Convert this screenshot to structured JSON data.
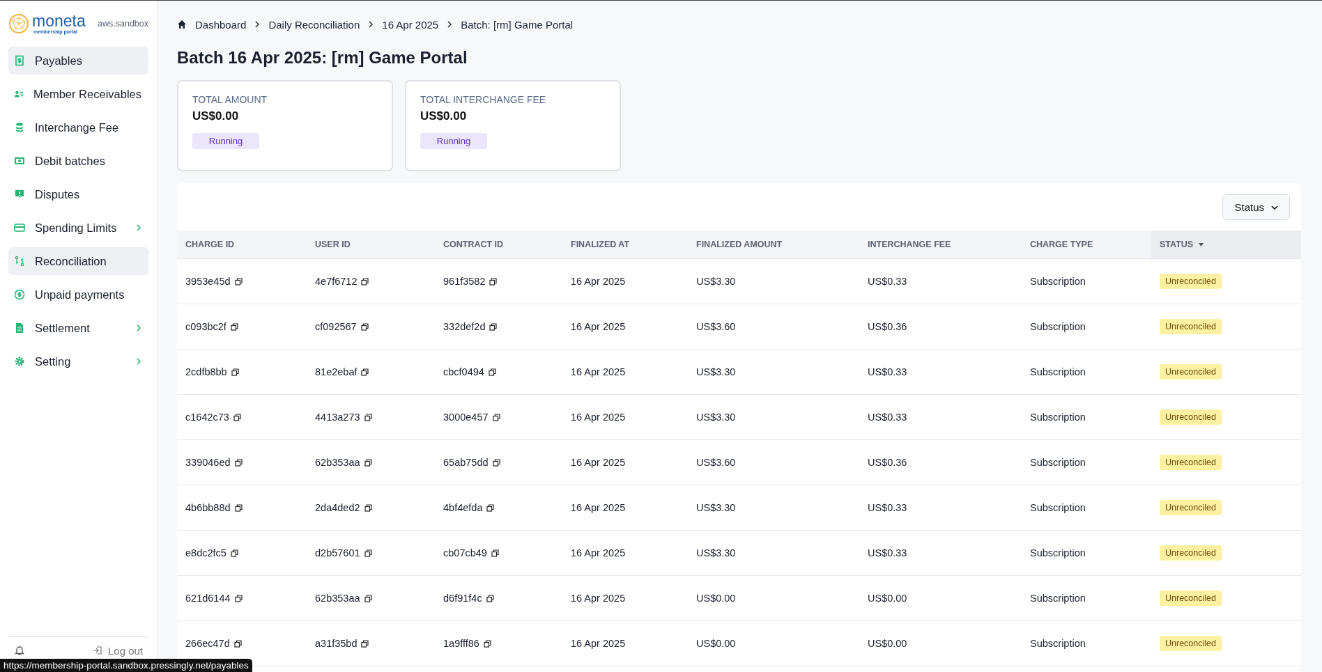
{
  "sidebar": {
    "logo": {
      "name": "moneta",
      "tagline": "membership portal"
    },
    "environment": "aws.sandbox",
    "items": [
      {
        "label": "Payables",
        "highlighted": true,
        "expandable": false
      },
      {
        "label": "Member Receivables",
        "highlighted": false,
        "expandable": false
      },
      {
        "label": "Interchange Fee",
        "highlighted": false,
        "expandable": false
      },
      {
        "label": "Debit batches",
        "highlighted": false,
        "expandable": false
      },
      {
        "label": "Disputes",
        "highlighted": false,
        "expandable": false
      },
      {
        "label": "Spending Limits",
        "highlighted": false,
        "expandable": true
      },
      {
        "label": "Reconciliation",
        "highlighted": true,
        "expandable": false
      },
      {
        "label": "Unpaid payments",
        "highlighted": false,
        "expandable": false
      },
      {
        "label": "Settlement",
        "highlighted": false,
        "expandable": true
      },
      {
        "label": "Setting",
        "highlighted": false,
        "expandable": true
      }
    ],
    "logout": "Log out"
  },
  "breadcrumbs": [
    "Dashboard",
    "Daily Reconciliation",
    "16 Apr 2025",
    "Batch: [rm] Game Portal"
  ],
  "title": "Batch 16 Apr 2025: [rm] Game Portal",
  "summary_cards": [
    {
      "label": "TOTAL AMOUNT",
      "value": "US$0.00",
      "status": "Running"
    },
    {
      "label": "TOTAL INTERCHANGE FEE",
      "value": "US$0.00",
      "status": "Running"
    }
  ],
  "filter_button": "Status",
  "table": {
    "columns": [
      {
        "label": "CHARGE ID",
        "kind": "copy",
        "sorted": false
      },
      {
        "label": "USER ID",
        "kind": "copy",
        "sorted": false
      },
      {
        "label": "CONTRACT ID",
        "kind": "copy",
        "sorted": false
      },
      {
        "label": "FINALIZED AT",
        "kind": "text",
        "sorted": false
      },
      {
        "label": "FINALIZED AMOUNT",
        "kind": "text",
        "sorted": false
      },
      {
        "label": "INTERCHANGE FEE",
        "kind": "text",
        "sorted": false
      },
      {
        "label": "CHARGE TYPE",
        "kind": "text",
        "sorted": false
      },
      {
        "label": "STATUS",
        "kind": "badge",
        "sorted": true
      }
    ],
    "rows": [
      [
        "3953e45d",
        "4e7f6712",
        "961f3582",
        "16 Apr 2025",
        "US$3.30",
        "US$0.33",
        "Subscription",
        "Unreconciled"
      ],
      [
        "c093bc2f",
        "cf092567",
        "332def2d",
        "16 Apr 2025",
        "US$3.60",
        "US$0.36",
        "Subscription",
        "Unreconciled"
      ],
      [
        "2cdfb8bb",
        "81e2ebaf",
        "cbcf0494",
        "16 Apr 2025",
        "US$3.30",
        "US$0.33",
        "Subscription",
        "Unreconciled"
      ],
      [
        "c1642c73",
        "4413a273",
        "3000e457",
        "16 Apr 2025",
        "US$3.30",
        "US$0.33",
        "Subscription",
        "Unreconciled"
      ],
      [
        "339046ed",
        "62b353aa",
        "65ab75dd",
        "16 Apr 2025",
        "US$3.60",
        "US$0.36",
        "Subscription",
        "Unreconciled"
      ],
      [
        "4b6bb88d",
        "2da4ded2",
        "4bf4efda",
        "16 Apr 2025",
        "US$3.30",
        "US$0.33",
        "Subscription",
        "Unreconciled"
      ],
      [
        "e8dc2fc5",
        "d2b57601",
        "cb07cb49",
        "16 Apr 2025",
        "US$3.30",
        "US$0.33",
        "Subscription",
        "Unreconciled"
      ],
      [
        "621d6144",
        "62b353aa",
        "d6f91f4c",
        "16 Apr 2025",
        "US$0.00",
        "US$0.00",
        "Subscription",
        "Unreconciled"
      ],
      [
        "266ec47d",
        "a31f35bd",
        "1a9fff86",
        "16 Apr 2025",
        "US$0.00",
        "US$0.00",
        "Subscription",
        "Unreconciled"
      ]
    ]
  },
  "status_url": "https://membership-portal.sandbox.pressingly.net/payables"
}
